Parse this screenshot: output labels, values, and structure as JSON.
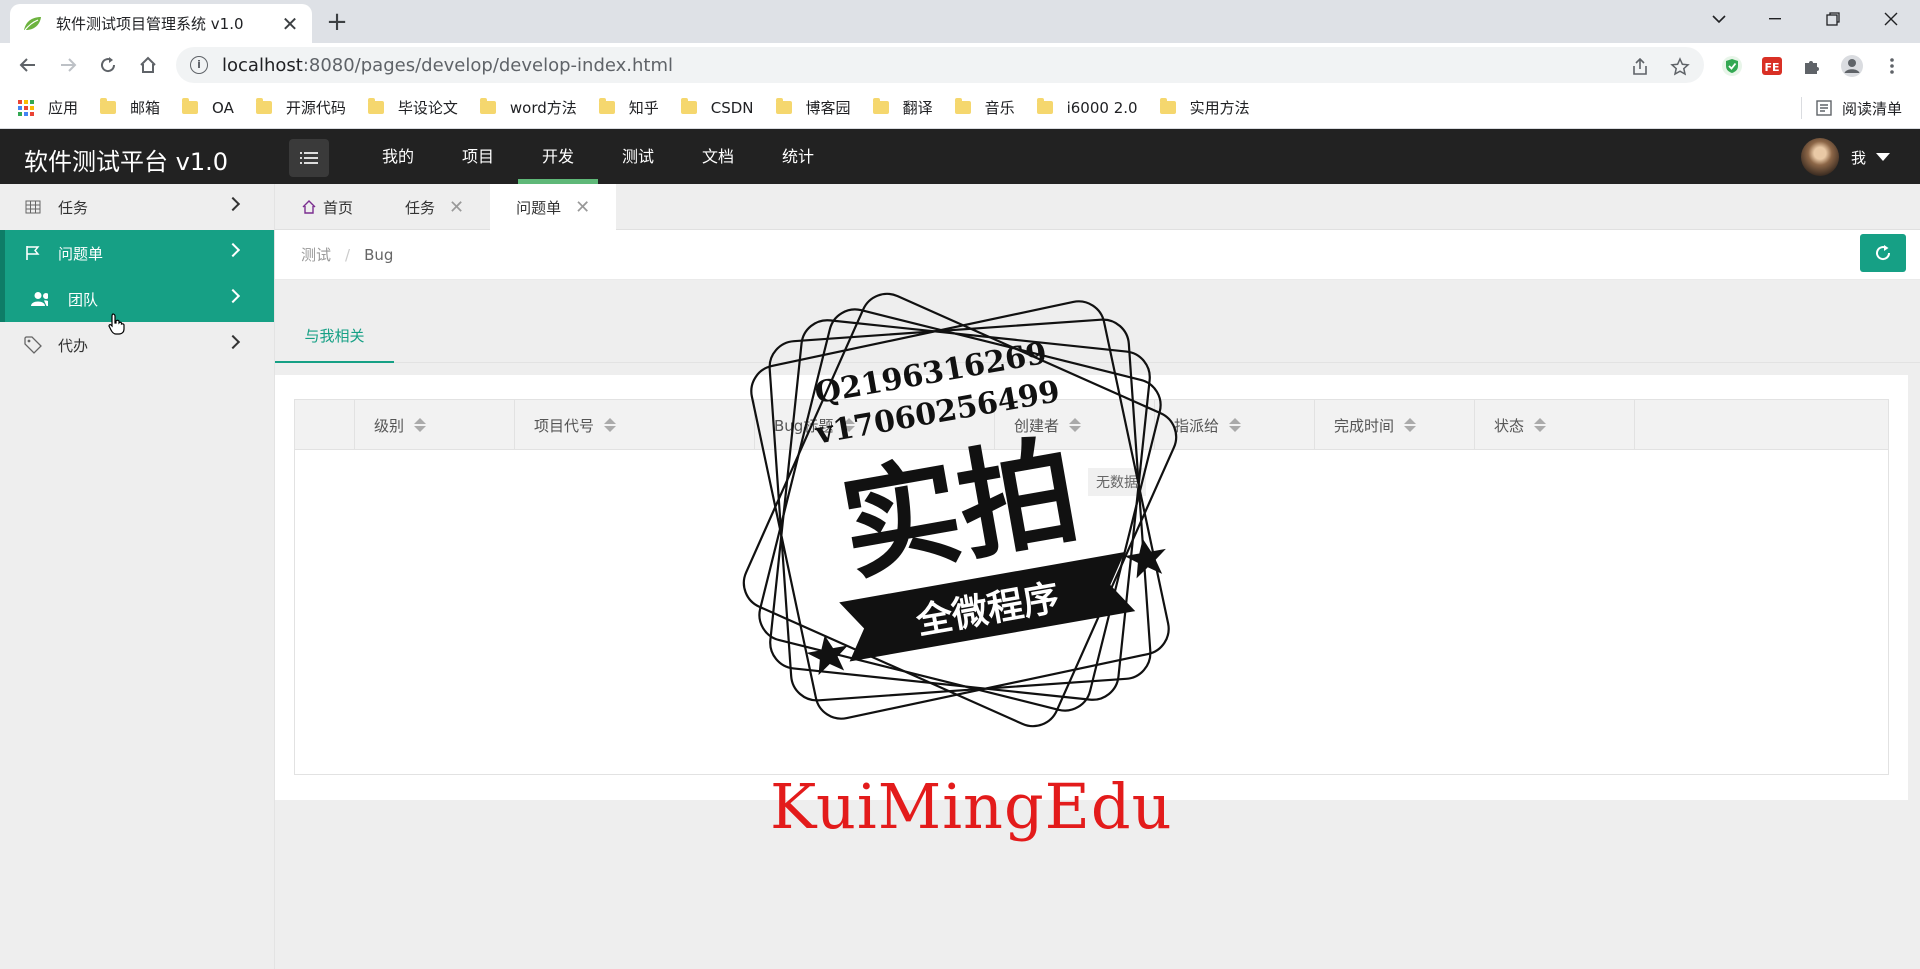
{
  "browser": {
    "tab_title": "软件测试项目管理系统 v1.0",
    "url_host": "localhost",
    "url_rest": ":8080/pages/develop/develop-index.html",
    "bookmarks": [
      "应用",
      "邮箱",
      "OA",
      "开源代码",
      "毕设论文",
      "word方法",
      "知乎",
      "CSDN",
      "博客园",
      "翻译",
      "音乐",
      "i6000 2.0",
      "实用方法"
    ],
    "reading_list": "阅读清单"
  },
  "app": {
    "title": "软件测试平台 v1.0",
    "top_nav": [
      "我的",
      "项目",
      "开发",
      "测试",
      "文档",
      "统计"
    ],
    "active_nav": "开发",
    "user": "我",
    "accent": "#16a085",
    "nav_underline": "#5fb878"
  },
  "sidebar": {
    "items": [
      {
        "label": "任务",
        "icon": "table-icon"
      },
      {
        "label": "问题单",
        "icon": "flag-icon"
      },
      {
        "label": "团队",
        "icon": "users-icon"
      },
      {
        "label": "代办",
        "icon": "tag-icon"
      }
    ]
  },
  "page_tabs": [
    {
      "label": "首页"
    },
    {
      "label": "任务",
      "close": "✕"
    },
    {
      "label": "问题单",
      "close": "✕"
    }
  ],
  "breadcrumb": {
    "parent": "测试",
    "sep": "/",
    "current": "Bug"
  },
  "sub_tab": "与我相关",
  "table": {
    "columns": [
      "",
      "级别",
      "项目代号",
      "Bug标题",
      "创建者",
      "指派给",
      "完成时间",
      "状态",
      ""
    ],
    "empty": "无数据"
  },
  "watermark": {
    "contact_q": "Q2196316269",
    "contact_v": "v17060256499",
    "stamp_main": "实拍",
    "stamp_ribbon": "全微程序",
    "brand": "KuiMingEdu"
  }
}
